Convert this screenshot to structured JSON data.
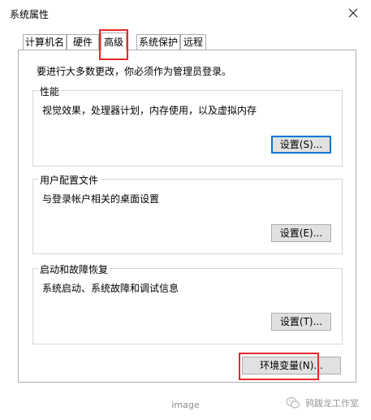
{
  "window": {
    "title": "系统属性"
  },
  "tabs": [
    "计算机名",
    "硬件",
    "高级",
    "系统保护",
    "远程"
  ],
  "active_tab": "高级",
  "admin_note": "要进行大多数更改，你必须作为管理员登录。",
  "groups": {
    "performance": {
      "title": "性能",
      "desc": "视觉效果，处理器计划，内存使用，以及虚拟内存",
      "button": "设置(S)..."
    },
    "user_profiles": {
      "title": "用户配置文件",
      "desc": "与登录帐户相关的桌面设置",
      "button": "设置(E)..."
    },
    "startup_recovery": {
      "title": "启动和故障恢复",
      "desc": "系统启动、系统故障和调试信息",
      "button": "设置(T)..."
    }
  },
  "env_button": "环境变量(N)...",
  "caption": "image",
  "watermark": "鸦跋龙工作室",
  "colors": {
    "highlight": "#e32a2a",
    "focus": "#0078d7",
    "button_bg": "#e1e1e1"
  },
  "icons": {
    "close": "close-icon",
    "watermark": "wechat-icon"
  }
}
